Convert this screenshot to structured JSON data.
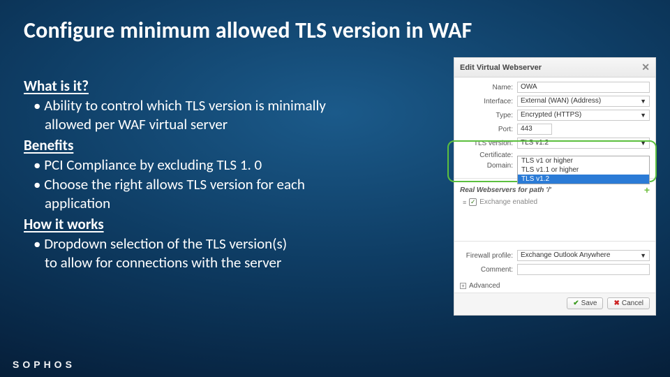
{
  "title": "Configure minimum allowed TLS version in WAF",
  "sections": {
    "what_h": "What is it?",
    "what_b1": "• Ability to control which TLS version is minimally",
    "what_b1c": "allowed per WAF virtual server",
    "benefits_h": "Benefits",
    "benefits_b1": "• PCI Compliance by excluding TLS 1. 0",
    "benefits_b2": "• Choose the right allows TLS version for each",
    "benefits_b2c": "application",
    "how_h": "How it works",
    "how_b1": "• Dropdown selection of the TLS version(s)",
    "how_b1c": "to allow for connections with the server"
  },
  "logo": "SOPHOS",
  "panel": {
    "title": "Edit Virtual Webserver",
    "close": "✕",
    "fields": {
      "name_lbl": "Name:",
      "name_val": "OWA",
      "interface_lbl": "Interface:",
      "interface_val": "External (WAN) (Address)",
      "type_lbl": "Type:",
      "type_val": "Encrypted (HTTPS)",
      "port_lbl": "Port:",
      "port_val": "443",
      "tls_lbl": "TLS version:",
      "tls_val": "TLS v1.2",
      "cert_lbl": "Certificate:",
      "domain_lbl": "Domain:",
      "fw_lbl": "Firewall profile:",
      "fw_val": "Exchange Outlook Anywhere",
      "comment_lbl": "Comment:",
      "comment_val": ""
    },
    "dd": {
      "opt1": "TLS v1 or higher",
      "opt2": "TLS v1.1 or higher",
      "opt3": "TLS v1.2"
    },
    "real_ws": "Real Webservers for path '/'",
    "check_label": "Exchange enabled",
    "advanced": "Advanced",
    "save": "Save",
    "cancel": "Cancel"
  }
}
